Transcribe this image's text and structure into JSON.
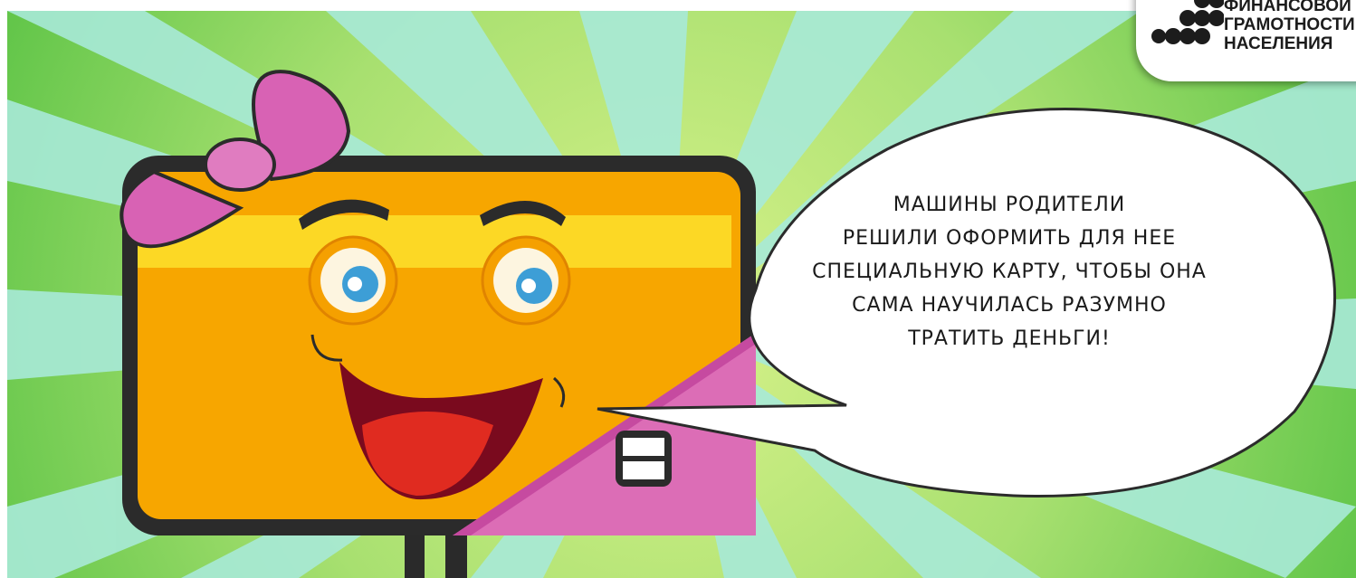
{
  "speech_bubble": {
    "lines": [
      "МАШИНЫ РОДИТЕЛИ",
      "РЕШИЛИ ОФОРМИТЬ ДЛЯ НЕЕ",
      "СПЕЦИАЛЬНУЮ КАРТУ, ЧТОБЫ ОНА",
      "САМА НАУЧИЛАСЬ РАЗУМНО",
      "ТРАТИТЬ ДЕНЬГИ!"
    ]
  },
  "logo": {
    "line1": "ФИНАНСОВОЙ",
    "line2": "ГРАМОТНОСТИ",
    "line3": "НАСЕЛЕНИЯ"
  },
  "colors": {
    "card_orange": "#f7a600",
    "card_stripe": "#fcd825",
    "bow_pink": "#dc6db6",
    "sky_green": "#b8e87a",
    "ray_mint": "#a8e8d6"
  }
}
